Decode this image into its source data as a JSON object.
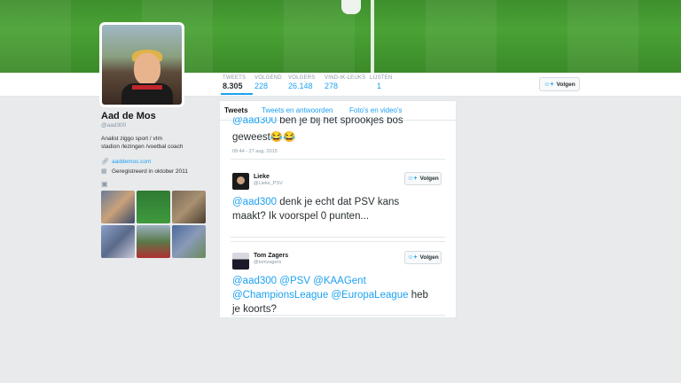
{
  "profile": {
    "name": "Aad de Mos",
    "handle": "@aad300",
    "bio_line1": "Analist ziggo sport / vtm",
    "bio_line2": "stadion /lezingen /voetbal coach",
    "website": "aaddemos.com",
    "joined": "Geregistreerd in oktober 2011"
  },
  "stats": [
    {
      "label": "TWEETS",
      "value": "8.305"
    },
    {
      "label": "VOLGEND",
      "value": "228"
    },
    {
      "label": "VOLGERS",
      "value": "26.148"
    },
    {
      "label": "VIND-IK-LEUKS",
      "value": "278"
    },
    {
      "label": "LIJSTEN",
      "value": "1"
    }
  ],
  "follow_label": "Volgen",
  "tabs": [
    "Tweets",
    "Tweets en antwoorden",
    "Foto's en video's"
  ],
  "tweets": [
    {
      "mention": "@aad300",
      "text_after": "ben je bij het sprookjes bos",
      "line2": "geweest😂😂",
      "time": "09:44 - 27 aug. 2015"
    },
    {
      "name": "Lieke",
      "handle": "@Lieke_PSV",
      "mention": "@aad300",
      "line1_rest": "denk je echt dat PSV kans",
      "line2": "maakt? Ik voorspel 0 punten..."
    },
    {
      "name": "Tom Zagers",
      "handle": "@tomzagers",
      "m1": "@aad300",
      "m2": "@PSV",
      "m3": "@KAAGent",
      "m4": "@ChampionsLeague",
      "m5": "@EuropaLeague",
      "rest1": "heb",
      "rest2": "je koorts?"
    }
  ],
  "icons": {
    "follow": "add-user-icon",
    "link": "link-icon",
    "calendar": "calendar-icon",
    "camera": "camera-icon"
  },
  "colors": {
    "accent": "#1da1f2",
    "banner": "#4aa234"
  }
}
